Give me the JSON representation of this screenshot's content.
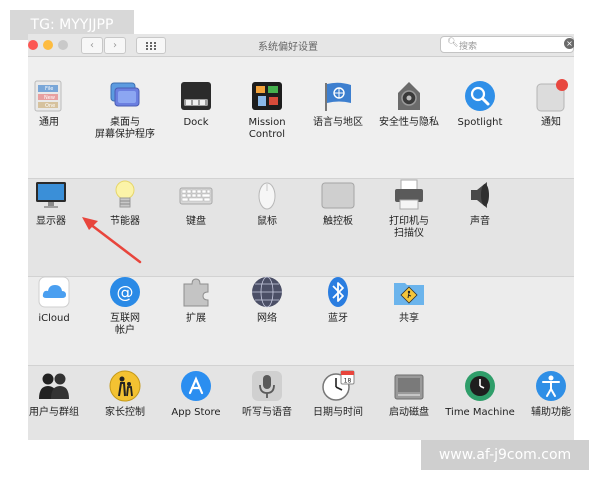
{
  "watermarks": {
    "top_left": "TG: MYYJJPP",
    "bottom_right": "www.af-j9com.com"
  },
  "window": {
    "title": "系统偏好设置",
    "back_glyph": "‹",
    "forward_glyph": "›",
    "search": {
      "placeholder": "搜索",
      "icon": "magnifier-icon",
      "clear_glyph": "×"
    }
  },
  "rows": [
    {
      "panes": [
        {
          "label": "通用",
          "icon": "general-icon"
        },
        {
          "label": "桌面与\n屏幕保护程序",
          "icon": "desktop-screensaver-icon"
        },
        {
          "label": "Dock",
          "icon": "dock-icon"
        },
        {
          "label": "Mission\nControl",
          "icon": "mission-control-icon"
        },
        {
          "label": "语言与地区",
          "icon": "language-region-icon"
        },
        {
          "label": "安全性与隐私",
          "icon": "security-privacy-icon"
        },
        {
          "label": "Spotlight",
          "icon": "spotlight-icon"
        },
        {
          "label": "通知",
          "icon": "notifications-icon"
        }
      ]
    },
    {
      "panes": [
        {
          "label": "显示器",
          "icon": "displays-icon"
        },
        {
          "label": "节能器",
          "icon": "energy-saver-icon"
        },
        {
          "label": "键盘",
          "icon": "keyboard-icon"
        },
        {
          "label": "鼠标",
          "icon": "mouse-icon"
        },
        {
          "label": "触控板",
          "icon": "trackpad-icon"
        },
        {
          "label": "打印机与\n扫描仪",
          "icon": "printers-scanners-icon"
        },
        {
          "label": "声音",
          "icon": "sound-icon"
        }
      ]
    },
    {
      "panes": [
        {
          "label": "iCloud",
          "icon": "icloud-icon"
        },
        {
          "label": "互联网\n帐户",
          "icon": "internet-accounts-icon"
        },
        {
          "label": "扩展",
          "icon": "extensions-icon"
        },
        {
          "label": "网络",
          "icon": "network-icon"
        },
        {
          "label": "蓝牙",
          "icon": "bluetooth-icon"
        },
        {
          "label": "共享",
          "icon": "sharing-icon"
        }
      ]
    },
    {
      "panes": [
        {
          "label": "用户与群组",
          "icon": "users-groups-icon"
        },
        {
          "label": "家长控制",
          "icon": "parental-controls-icon"
        },
        {
          "label": "App Store",
          "icon": "app-store-icon"
        },
        {
          "label": "听写与语音",
          "icon": "dictation-speech-icon"
        },
        {
          "label": "日期与时间",
          "icon": "date-time-icon"
        },
        {
          "label": "启动磁盘",
          "icon": "startup-disk-icon"
        },
        {
          "label": "Time Machine",
          "icon": "time-machine-icon"
        },
        {
          "label": "辅助功能",
          "icon": "accessibility-icon"
        }
      ]
    }
  ],
  "annotation": {
    "icon": "red-arrow-icon",
    "color": "#e8453c"
  }
}
